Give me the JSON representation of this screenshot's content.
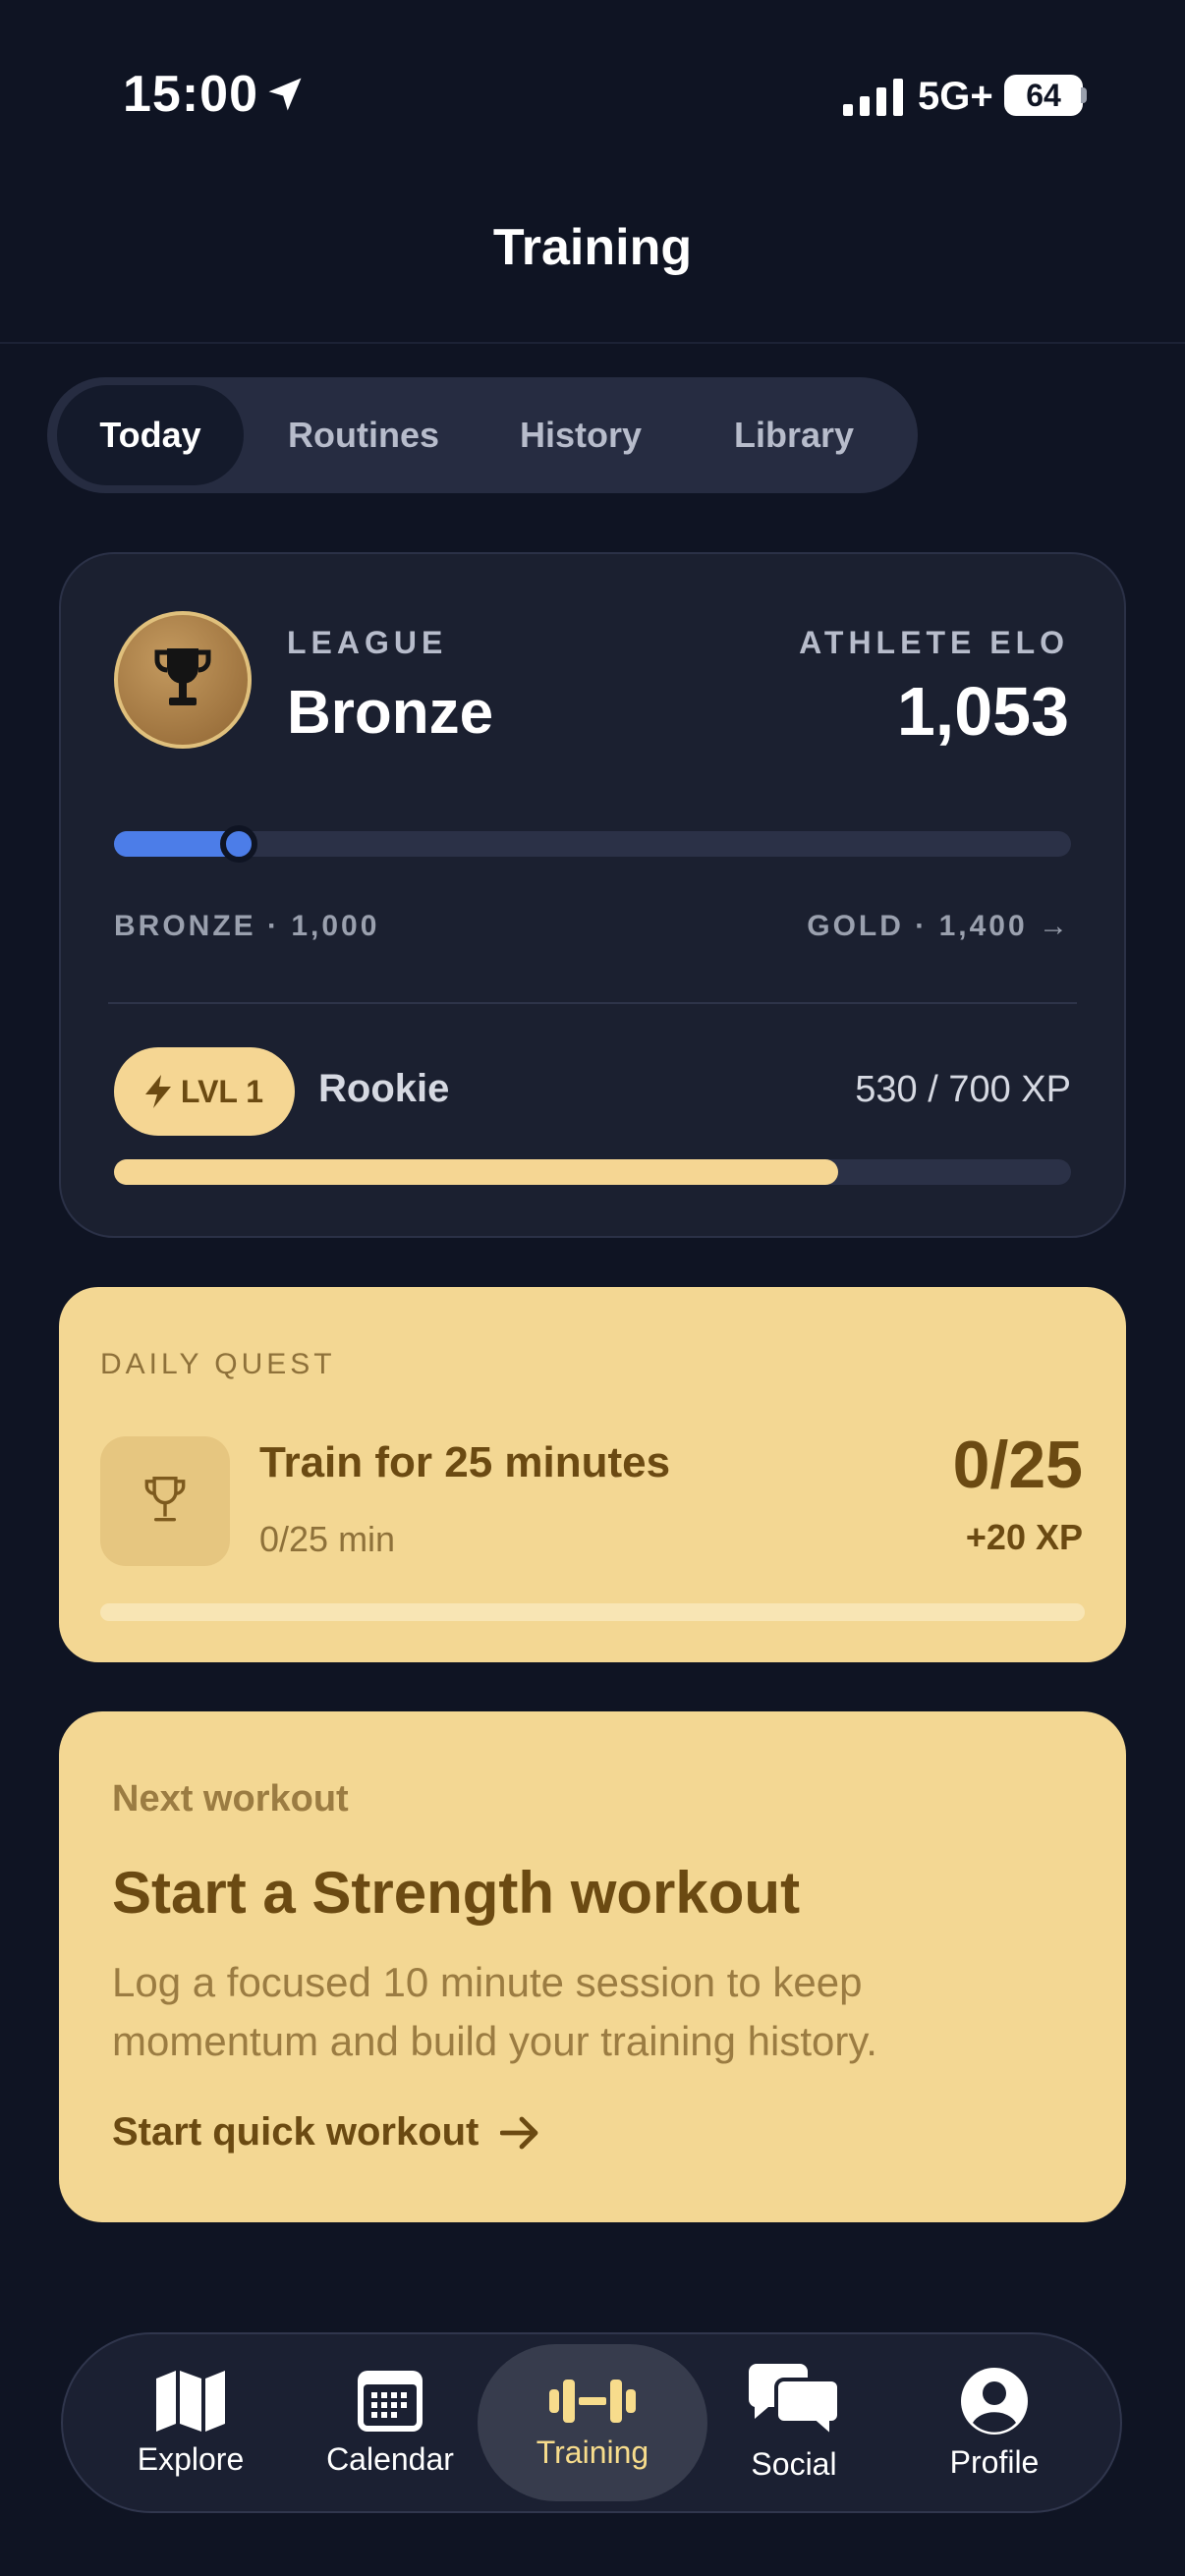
{
  "status_bar": {
    "time": "15:00",
    "network": "5G+",
    "battery": "64"
  },
  "header": {
    "title": "Training"
  },
  "tabs": [
    {
      "label": "Today",
      "active": true
    },
    {
      "label": "Routines",
      "active": false
    },
    {
      "label": "History",
      "active": false
    },
    {
      "label": "Library",
      "active": false
    }
  ],
  "league": {
    "label": "LEAGUE",
    "name": "Bronze",
    "elo_label": "ATHLETE ELO",
    "elo_value": "1,053",
    "elo_progress": 0.13,
    "range_start": "BRONZE · 1,000",
    "range_end": "GOLD · 1,400 →",
    "level_badge": "LVL 1",
    "rank": "Rookie",
    "xp_text": "530 / 700 XP",
    "xp_progress": 0.757
  },
  "daily_quest": {
    "label": "DAILY QUEST",
    "title": "Train for 25 minutes",
    "subtitle": "0/25 min",
    "count": "0/25",
    "reward": "+20 XP",
    "progress": 0
  },
  "next_workout": {
    "label": "Next workout",
    "title": "Start a Strength workout",
    "description": "Log a focused 10 minute session to keep momentum and build your training history.",
    "cta": "Start quick workout"
  },
  "nav": [
    {
      "label": "Explore",
      "icon": "map-icon",
      "active": false
    },
    {
      "label": "Calendar",
      "icon": "calendar-icon",
      "active": false
    },
    {
      "label": "Training",
      "icon": "dumbbell-icon",
      "active": true
    },
    {
      "label": "Social",
      "icon": "chat-bubbles-icon",
      "active": false
    },
    {
      "label": "Profile",
      "icon": "profile-icon",
      "active": false
    }
  ],
  "colors": {
    "background": "#0f1423",
    "card": "#1b2030",
    "accent_blue": "#4c7de8",
    "accent_gold": "#f3d793",
    "gold_text": "#6b4a12"
  }
}
